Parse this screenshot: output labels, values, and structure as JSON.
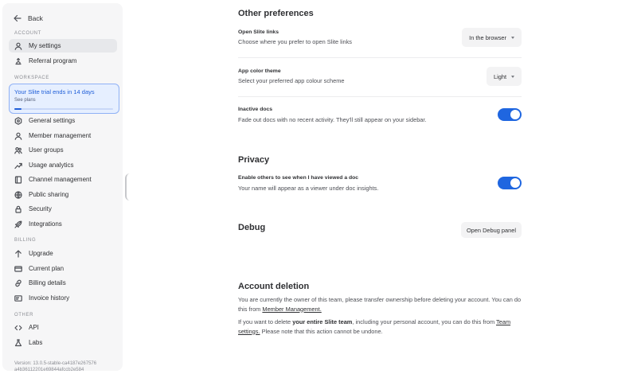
{
  "sidebar": {
    "back_label": "Back",
    "sections": {
      "account": "ACCOUNT",
      "workspace": "WORKSPACE",
      "billing": "BILLING",
      "other": "OTHER"
    },
    "account_items": [
      {
        "label": "My settings",
        "icon": "user-icon",
        "active": true
      },
      {
        "label": "Referral program",
        "icon": "gift-icon"
      }
    ],
    "trial": {
      "title": "Your Slite trial ends in 14 days",
      "subtitle": "See plans",
      "progress": 0.07
    },
    "workspace_items": [
      {
        "label": "General settings",
        "icon": "hexagon-gear-icon"
      },
      {
        "label": "Member management",
        "icon": "user-icon"
      },
      {
        "label": "User groups",
        "icon": "users-icon"
      },
      {
        "label": "Usage analytics",
        "icon": "trend-up-icon"
      },
      {
        "label": "Channel management",
        "icon": "book-icon"
      },
      {
        "label": "Public sharing",
        "icon": "globe-icon"
      },
      {
        "label": "Security",
        "icon": "lock-icon"
      },
      {
        "label": "Integrations",
        "icon": "rocket-icon"
      }
    ],
    "billing_items": [
      {
        "label": "Upgrade",
        "icon": "arrow-up-icon"
      },
      {
        "label": "Current plan",
        "icon": "credit-card-icon"
      },
      {
        "label": "Billing details",
        "icon": "link-icon"
      },
      {
        "label": "Invoice history",
        "icon": "receipt-icon"
      }
    ],
    "other_items": [
      {
        "label": "API",
        "icon": "code-icon"
      },
      {
        "label": "Labs",
        "icon": "flask-icon"
      }
    ],
    "version_line1": "Version: 13.0.5-stable-ca4187e267576",
    "version_line2": "a4b36112201e69844afccb2e584"
  },
  "main": {
    "other_preferences": {
      "heading": "Other preferences",
      "open_links": {
        "title": "Open Slite links",
        "description": "Choose where you prefer to open Slite links",
        "value": "In the browser"
      },
      "theme": {
        "title": "App color theme",
        "description": "Select your preferred app colour scheme",
        "value": "Light"
      },
      "inactive": {
        "title": "Inactive docs",
        "description": "Fade out docs with no recent activity. They'll still appear on your sidebar.",
        "enabled": true
      }
    },
    "privacy": {
      "heading": "Privacy",
      "viewed": {
        "title": "Enable others to see when I have viewed a doc",
        "description": "Your name will appear as a viewer under doc insights.",
        "enabled": true
      }
    },
    "debug": {
      "heading": "Debug",
      "button_label": "Open Debug panel"
    },
    "deletion": {
      "heading": "Account deletion",
      "para1_text": "You are currently the owner of this team, please transfer ownership before deleting your account. You can do this from",
      "para1_link": "Member Management.",
      "para2_pre": "If you want to delete",
      "para2_bold": "your entire Slite team",
      "para2_mid": ", including your personal account, you can do this from",
      "para2_link": "Team settings.",
      "para2_post": "Please note that this action cannot be undone."
    }
  },
  "colors": {
    "accent": "#1f66e0",
    "trial_bg": "#e6efff",
    "sidebar_bg": "#f6f6f7"
  }
}
